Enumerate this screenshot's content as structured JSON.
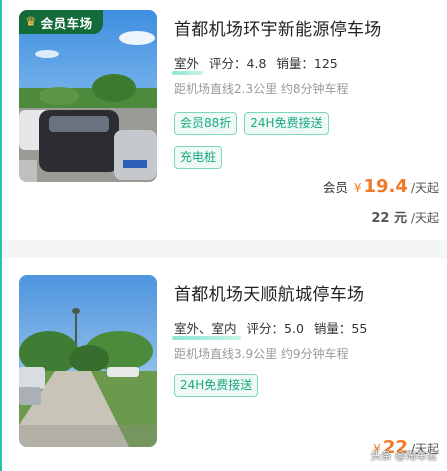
{
  "listings": [
    {
      "badge": {
        "icon": "crown-icon",
        "label": "会员车场"
      },
      "title": "首都机场环宇新能源停车场",
      "location": "室外",
      "rating_label": "评分：4.8",
      "sales_label": "销量：125",
      "distance": "距机场直线2.3公里 约8分钟车程",
      "tags_row1": [
        "会员88折",
        "24H免费接送"
      ],
      "tags_row2": [
        "充电桩"
      ],
      "member_label": "会员",
      "currency": "¥",
      "member_price": "19.4",
      "price_unit": "/天起",
      "original_price": "22 元",
      "original_unit": "/天起"
    },
    {
      "title": "首都机场天顺航城停车场",
      "location": "室外、室内",
      "rating_label": "评分：5.0",
      "sales_label": "销量：55",
      "distance": "距机场直线3.9公里 约9分钟车程",
      "tags_row1": [
        "24H免费接送"
      ],
      "currency": "¥",
      "price": "22",
      "price_unit": "/天起"
    }
  ],
  "watermark": "头条 @淘车位",
  "colors": {
    "accent": "#2bc2a6",
    "price": "#f07a28",
    "tag_text": "#1aa882",
    "badge_bg": "#146b3a"
  }
}
